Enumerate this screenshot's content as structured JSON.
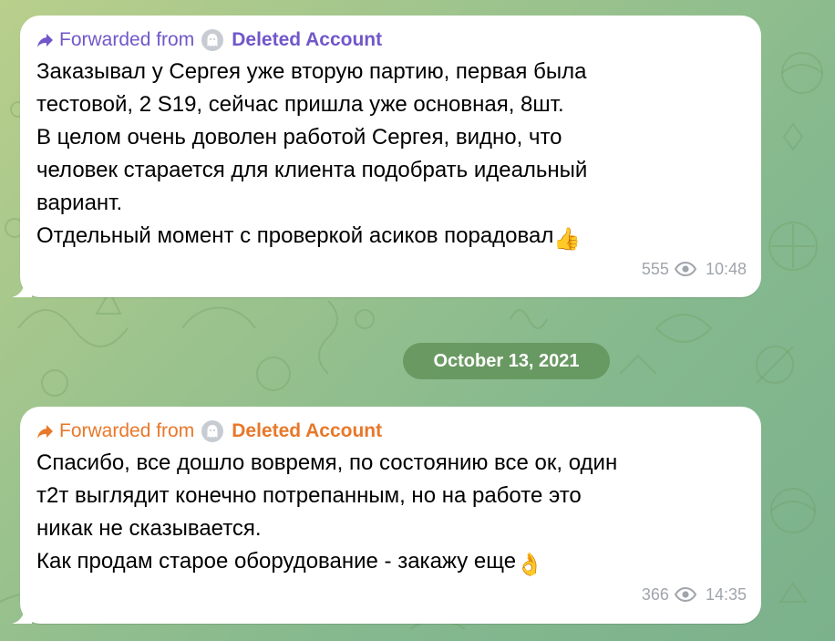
{
  "colors": {
    "forward_purple": "#7157c9",
    "forward_orange": "#e8782a",
    "meta_gray": "#a0a5ab",
    "date_pill_bg": "#5c8c52"
  },
  "messages": [
    {
      "forward_prefix": "Forwarded from",
      "forward_name": "Deleted Account",
      "avatar_icon": "ghost-icon",
      "forward_icon": "share-arrow-icon",
      "text": "Заказывал у Сергея уже вторую партию, первая была\nтестовой, 2 S19, сейчас пришла уже основная, 8шт.\nВ целом очень доволен работой Сергея, видно, что\nчеловек старается для клиента подобрать идеальный\nвариант.\nОтдельный момент с проверкой асиков порадовал",
      "emoji": "👍",
      "emoji_icon": "thumbs-up-icon",
      "views": "555",
      "time": "10:48"
    },
    {
      "forward_prefix": "Forwarded from",
      "forward_name": "Deleted Account",
      "avatar_icon": "ghost-icon",
      "forward_icon": "share-arrow-icon",
      "text": "Спасибо, все дошло вовремя, по состоянию все ок, один\nт2т выглядит конечно потрепанным, но на работе это\nникак не сказывается.\nКак продам старое оборудование - закажу еще",
      "emoji": "👌",
      "emoji_icon": "ok-hand-icon",
      "views": "366",
      "time": "14:35"
    }
  ],
  "date_separator": "October 13, 2021"
}
